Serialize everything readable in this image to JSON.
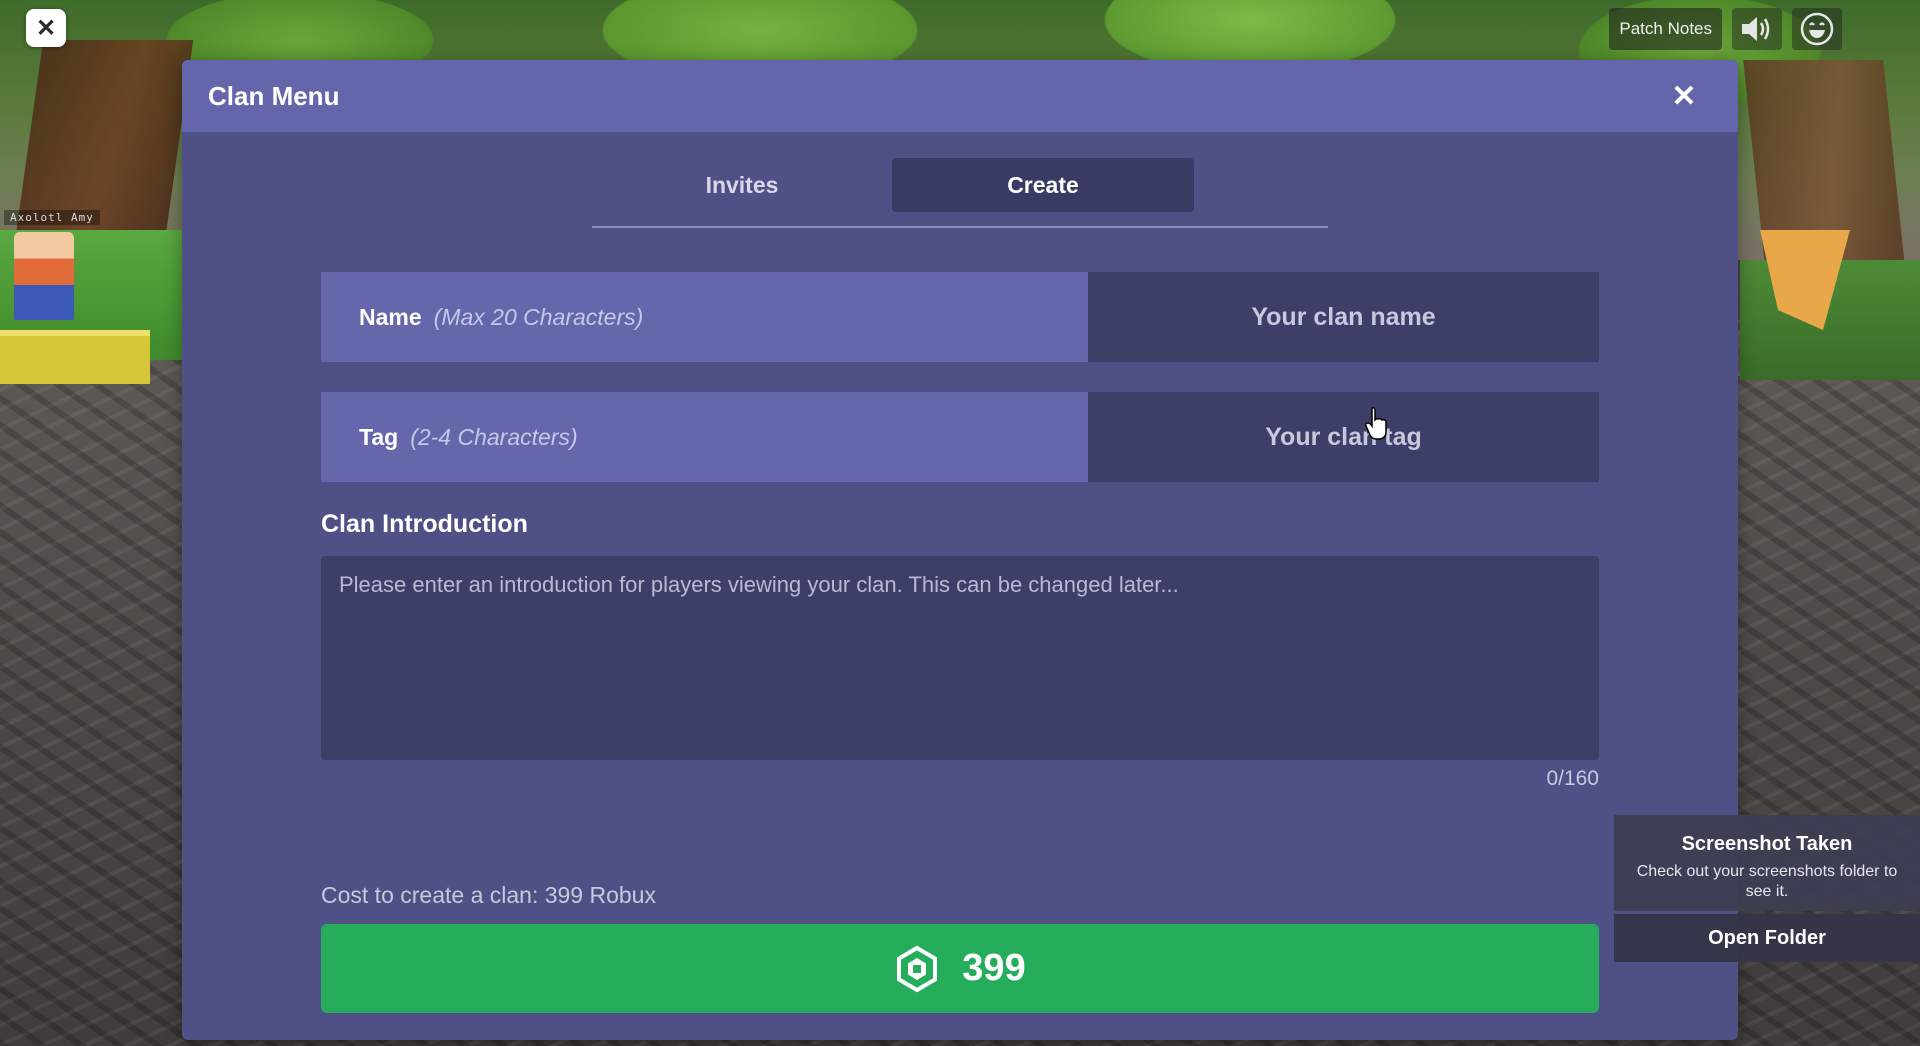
{
  "topbar": {
    "patch_notes_label": "Patch Notes",
    "volume_icon": "speaker-icon",
    "emote_icon": "smiley-icon",
    "close_icon": "close-icon"
  },
  "world": {
    "avatar_nametag": "Axolotl Amy"
  },
  "dialog": {
    "title": "Clan Menu",
    "close_icon": "close-icon",
    "tabs": [
      {
        "label": "Invites",
        "selected": false
      },
      {
        "label": "Create",
        "selected": true
      }
    ],
    "name_field": {
      "label": "Name",
      "hint": "(Max 20 Characters)",
      "placeholder": "Your clan name",
      "value": ""
    },
    "tag_field": {
      "label": "Tag",
      "hint": "(2-4 Characters)",
      "placeholder": "Your clan tag",
      "value": ""
    },
    "introduction": {
      "title": "Clan Introduction",
      "placeholder": "Please enter an introduction for players viewing your clan. This can be changed later...",
      "value": "",
      "char_count": "0/160"
    },
    "cost_text": "Cost to create a clan: 399 Robux",
    "buy_button": {
      "icon": "robux-icon",
      "price": "399"
    }
  },
  "toast": {
    "title": "Screenshot Taken",
    "message": "Check out your screenshots folder to see it.",
    "button_label": "Open Folder"
  },
  "colors": {
    "dialog_bg": "#4f5086",
    "header_bg": "#6465aa",
    "field_label_bg": "#6667ab",
    "input_bg": "#3e3f69",
    "buy_green": "#25ad5c"
  }
}
